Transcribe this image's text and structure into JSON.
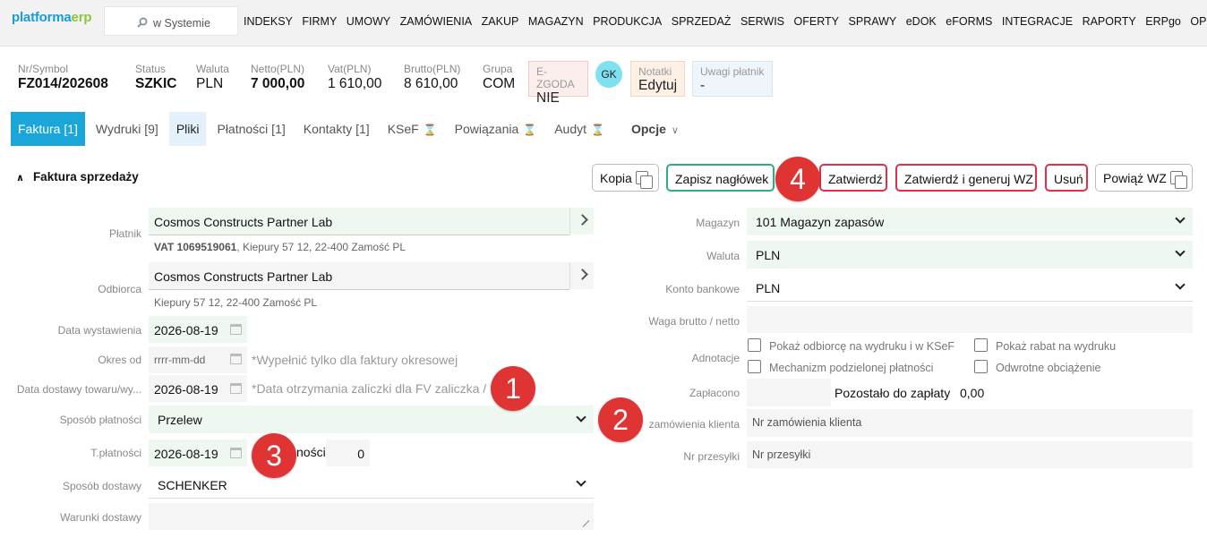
{
  "logo": {
    "part1": "platforma",
    "part2": "erp"
  },
  "search": {
    "placeholder": "w Systemie"
  },
  "menu": [
    "INDEKSY",
    "FIRMY",
    "UMOWY",
    "ZAMÓWIENIA",
    "ZAKUP",
    "MAGAZYN",
    "PRODUKCJA",
    "SPRZEDAŻ",
    "SERWIS",
    "OFERTY",
    "SPRAWY",
    "eDOK",
    "eFORMS",
    "INTEGRACJE",
    "RAPORTY",
    "ERPgo",
    "OPCJE"
  ],
  "header": {
    "symbol": {
      "label": "Nr/Symbol",
      "value": "FZ014/202608"
    },
    "status": {
      "label": "Status",
      "value": "SZKIC"
    },
    "waluta": {
      "label": "Waluta",
      "value": "PLN"
    },
    "netto": {
      "label": "Netto(PLN)",
      "value": "7 000,00"
    },
    "vat": {
      "label": "Vat(PLN)",
      "value": "1 610,00"
    },
    "brutto": {
      "label": "Brutto(PLN)",
      "value": "8 610,00"
    },
    "grupa": {
      "label": "Grupa",
      "value": "COM"
    },
    "ezgoda": {
      "label": "E-ZGODA",
      "value": "NIE"
    },
    "avatar": "GK",
    "notatki": {
      "label": "Notatki",
      "value": "Edytuj"
    },
    "uwagi": {
      "label": "Uwagi płatnik",
      "value": "-"
    }
  },
  "tabs": {
    "faktura": "Faktura [1]",
    "wydruki": "Wydruki [9]",
    "pliki": "Pliki",
    "platnosci": "Płatności [1]",
    "kontakty": "Kontakty [1]",
    "ksef": "KSeF",
    "powiazania": "Powiązania",
    "audyt": "Audyt",
    "opcje": "Opcje"
  },
  "section": {
    "title": "Faktura sprzedaży"
  },
  "buttons": {
    "kopia": "Kopia",
    "zapisz": "Zapisz nagłówek",
    "zatwierdz": "Zatwierdź",
    "zatwierdz_generuj": "Zatwierdź i generuj WZ",
    "usun": "Usuń",
    "powiaz": "Powiąż WZ"
  },
  "badges": [
    "1",
    "2",
    "3",
    "4"
  ],
  "left": {
    "platnik": {
      "label": "Płatnik",
      "value": "Cosmos Constructs Partner Lab",
      "vat": "VAT 1069519061",
      "address": ", Kiepury 57 12, 22-400 Zamość PL"
    },
    "odbiorca": {
      "label": "Odbiorca",
      "value": "Cosmos Constructs Partner Lab",
      "address": "Kiepury 57 12, 22-400 Zamość PL"
    },
    "data_wystawienia": {
      "label": "Data wystawienia",
      "value": "2026-08-19"
    },
    "okres_od": {
      "label": "Okres od",
      "placeholder": "rrrr-mm-dd",
      "hint": "*Wypełnić tylko dla faktury okresowej"
    },
    "data_dostawy": {
      "label": "Data dostawy towaru/wy...",
      "value": "2026-08-19",
      "hint": "*Data otrzymania zaliczki dla FV zaliczka / ...o"
    },
    "sposob_platnosci": {
      "label": "Sposób płatności",
      "value": "Przelew"
    },
    "t_platnosci": {
      "label": "T.płatności",
      "value": "2026-08-19",
      "after_label": "ności",
      "days": "0"
    },
    "sposob_dostawy": {
      "label": "Sposób dostawy",
      "value": "SCHENKER"
    },
    "warunki_dostawy": {
      "label": "Warunki dostawy",
      "value": ""
    }
  },
  "right": {
    "magazyn": {
      "label": "Magazyn",
      "value": "101 Magazyn zapasów"
    },
    "waluta": {
      "label": "Waluta",
      "value": "PLN"
    },
    "konto": {
      "label": "Konto bankowe",
      "value": "PLN"
    },
    "waga": {
      "label": "Waga brutto / netto",
      "value": ""
    },
    "adnotacje": {
      "label": "Adnotacje",
      "items": [
        "Pokaż odbiorcę na wydruku i w KSeF",
        "Pokaż rabat na wydruku",
        "Mechanizm podzielonej płatności",
        "Odwrotne obciążenie"
      ]
    },
    "zaplacono": {
      "label": "Zapłacono",
      "value": "",
      "pozostalo_label": "Pozostało do zapłaty",
      "pozostalo_value": "0,00"
    },
    "nr_zamowienia": {
      "label": "zamówienia klienta",
      "placeholder": "Nr zamówienia klienta"
    },
    "nr_przesylki": {
      "label": "Nr przesyłki",
      "placeholder": "Nr przesyłki"
    }
  }
}
